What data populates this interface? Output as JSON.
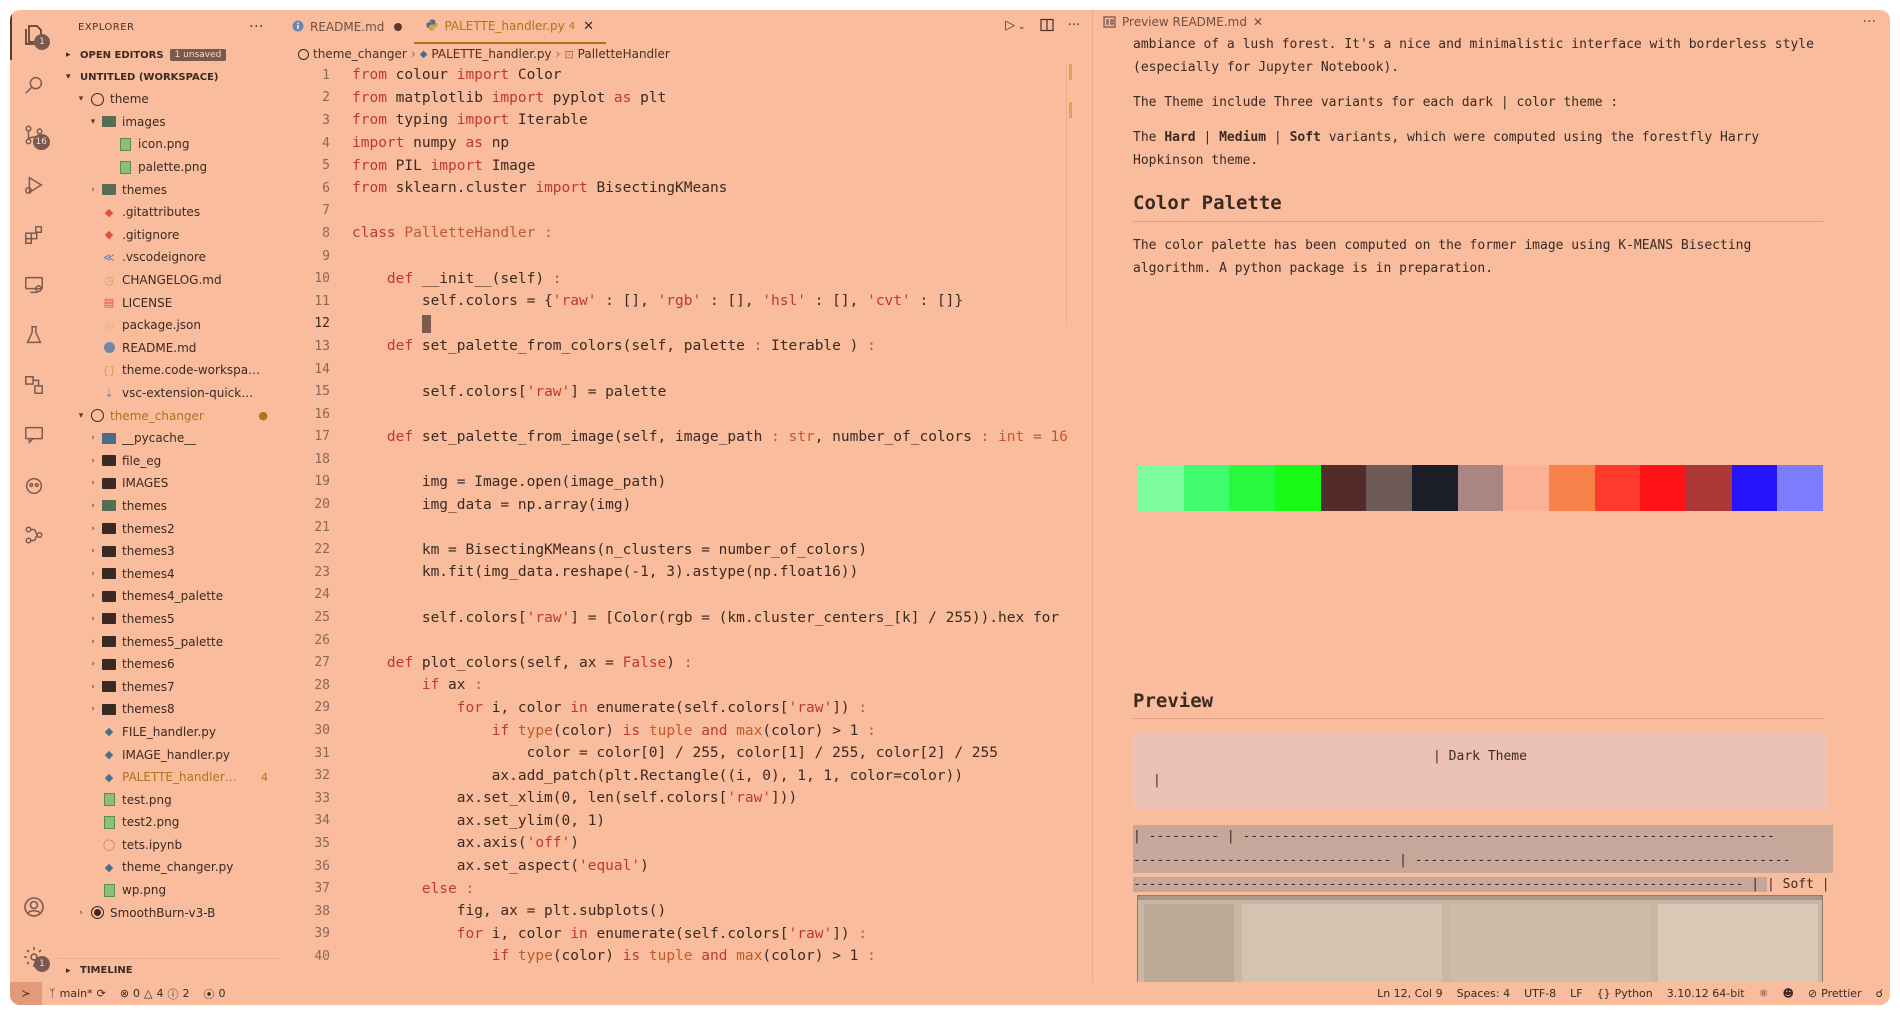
{
  "activity": {
    "explorer_badge": "1",
    "scm_badge": "16",
    "settings_badge": "1"
  },
  "sidebar": {
    "title": "EXPLORER",
    "open_editors": "OPEN EDITORS",
    "unsaved": "1 unsaved",
    "workspace": "UNTITLED (WORKSPACE)",
    "timeline": "TIMELINE",
    "tree": [
      {
        "label": "theme",
        "indent": 1,
        "kind": "root",
        "chev": "v"
      },
      {
        "label": "images",
        "indent": 2,
        "kind": "imgfolder",
        "chev": "v"
      },
      {
        "label": "icon.png",
        "indent": 3,
        "kind": "image",
        "chev": ""
      },
      {
        "label": "palette.png",
        "indent": 3,
        "kind": "image",
        "chev": ""
      },
      {
        "label": "themes",
        "indent": 2,
        "kind": "imgfolder",
        "chev": ">"
      },
      {
        "label": ".gitattributes",
        "indent": 2,
        "kind": "git",
        "chev": ""
      },
      {
        "label": ".gitignore",
        "indent": 2,
        "kind": "git",
        "chev": ""
      },
      {
        "label": ".vscodeignore",
        "indent": 2,
        "kind": "vscode",
        "chev": ""
      },
      {
        "label": "CHANGELOG.md",
        "indent": 2,
        "kind": "changelog",
        "chev": ""
      },
      {
        "label": "LICENSE",
        "indent": 2,
        "kind": "license",
        "chev": ""
      },
      {
        "label": "package.json",
        "indent": 2,
        "kind": "npm",
        "chev": ""
      },
      {
        "label": "README.md",
        "indent": 2,
        "kind": "info",
        "chev": ""
      },
      {
        "label": "theme.code-workspace",
        "indent": 2,
        "kind": "json",
        "chev": ""
      },
      {
        "label": "vsc-extension-quick…",
        "indent": 2,
        "kind": "md",
        "chev": ""
      },
      {
        "label": "theme_changer",
        "indent": 1,
        "kind": "root",
        "chev": "v",
        "modified": true,
        "mark": "●"
      },
      {
        "label": "__pycache__",
        "indent": 2,
        "kind": "pyfolder",
        "chev": ">"
      },
      {
        "label": "file_eg",
        "indent": 2,
        "kind": "folder",
        "chev": ">"
      },
      {
        "label": "IMAGES",
        "indent": 2,
        "kind": "folder",
        "chev": ">"
      },
      {
        "label": "themes",
        "indent": 2,
        "kind": "imgfolder",
        "chev": ">"
      },
      {
        "label": "themes2",
        "indent": 2,
        "kind": "folder",
        "chev": ">"
      },
      {
        "label": "themes3",
        "indent": 2,
        "kind": "folder",
        "chev": ">"
      },
      {
        "label": "themes4",
        "indent": 2,
        "kind": "folder",
        "chev": ">"
      },
      {
        "label": "themes4_palette",
        "indent": 2,
        "kind": "folder",
        "chev": ">"
      },
      {
        "label": "themes5",
        "indent": 2,
        "kind": "folder",
        "chev": ">"
      },
      {
        "label": "themes5_palette",
        "indent": 2,
        "kind": "folder",
        "chev": ">"
      },
      {
        "label": "themes6",
        "indent": 2,
        "kind": "folder",
        "chev": ">"
      },
      {
        "label": "themes7",
        "indent": 2,
        "kind": "folder",
        "chev": ">"
      },
      {
        "label": "themes8",
        "indent": 2,
        "kind": "folder",
        "chev": ">"
      },
      {
        "label": "FILE_handler.py",
        "indent": 2,
        "kind": "python",
        "chev": ""
      },
      {
        "label": "IMAGE_handler.py",
        "indent": 2,
        "kind": "python",
        "chev": ""
      },
      {
        "label": "PALETTE_handler…",
        "indent": 2,
        "kind": "python",
        "chev": "",
        "modified": true,
        "mark": "4"
      },
      {
        "label": "test.png",
        "indent": 2,
        "kind": "image",
        "chev": ""
      },
      {
        "label": "test2.png",
        "indent": 2,
        "kind": "image",
        "chev": ""
      },
      {
        "label": "tets.ipynb",
        "indent": 2,
        "kind": "notebook",
        "chev": ""
      },
      {
        "label": "theme_changer.py",
        "indent": 2,
        "kind": "python",
        "chev": ""
      },
      {
        "label": "wp.png",
        "indent": 2,
        "kind": "image",
        "chev": ""
      },
      {
        "label": "SmoothBurn-v3-B",
        "indent": 1,
        "kind": "root2",
        "chev": ">"
      }
    ]
  },
  "editor": {
    "tabs": [
      {
        "label": "README.md",
        "icon": "info",
        "dirty": true
      },
      {
        "label": "PALETTE_handler.py",
        "icon": "python",
        "count": "4",
        "active": true
      }
    ],
    "breadcrumb": [
      "theme_changer",
      "PALETTE_handler.py",
      "PalletteHandler"
    ],
    "current_line": "12",
    "lines": [
      {
        "n": "1",
        "tokens": [
          [
            "kw",
            "from "
          ],
          [
            "",
            "colour "
          ],
          [
            "kw",
            "import "
          ],
          [
            "",
            "Color"
          ]
        ]
      },
      {
        "n": "2",
        "tokens": [
          [
            "kw",
            "from "
          ],
          [
            "",
            "matplotlib "
          ],
          [
            "kw",
            "import "
          ],
          [
            "",
            "pyplot "
          ],
          [
            "kw",
            "as "
          ],
          [
            "",
            "plt"
          ]
        ]
      },
      {
        "n": "3",
        "tokens": [
          [
            "kw",
            "from "
          ],
          [
            "",
            "typing "
          ],
          [
            "kw",
            "import "
          ],
          [
            "",
            "Iterable"
          ]
        ]
      },
      {
        "n": "4",
        "tokens": [
          [
            "kw",
            "import "
          ],
          [
            "",
            "numpy "
          ],
          [
            "kw",
            "as "
          ],
          [
            "",
            "np"
          ]
        ]
      },
      {
        "n": "5",
        "tokens": [
          [
            "kw",
            "from "
          ],
          [
            "",
            "PIL "
          ],
          [
            "kw",
            "import "
          ],
          [
            "",
            "Image"
          ]
        ]
      },
      {
        "n": "6",
        "tokens": [
          [
            "kw",
            "from "
          ],
          [
            "",
            "sklearn.cluster "
          ],
          [
            "kw",
            "import "
          ],
          [
            "",
            "BisectingKMeans"
          ]
        ]
      },
      {
        "n": "7",
        "tokens": []
      },
      {
        "n": "8",
        "tokens": [
          [
            "kw",
            "class "
          ],
          [
            "ty",
            "PalletteHandler "
          ],
          [
            "op",
            ":"
          ]
        ]
      },
      {
        "n": "9",
        "tokens": []
      },
      {
        "n": "10",
        "tokens": [
          [
            "",
            "    "
          ],
          [
            "kw",
            "def "
          ],
          [
            "",
            "__init__(self) "
          ],
          [
            "op",
            ":"
          ]
        ]
      },
      {
        "n": "11",
        "tokens": [
          [
            "",
            "        self.colors = {"
          ],
          [
            "st",
            "'raw'"
          ],
          [
            "",
            " : [], "
          ],
          [
            "st",
            "'rgb'"
          ],
          [
            "",
            " : [], "
          ],
          [
            "st",
            "'hsl'"
          ],
          [
            "",
            " : [], "
          ],
          [
            "st",
            "'cvt'"
          ],
          [
            "",
            " : []}"
          ]
        ]
      },
      {
        "n": "12",
        "tokens": [
          [
            "",
            "        "
          ],
          [
            "cursor",
            ""
          ]
        ]
      },
      {
        "n": "13",
        "tokens": [
          [
            "",
            "    "
          ],
          [
            "kw",
            "def "
          ],
          [
            "",
            "set_palette_from_colors(self, palette "
          ],
          [
            "op",
            ": "
          ],
          [
            "",
            "Iterable ) "
          ],
          [
            "op",
            ":"
          ]
        ]
      },
      {
        "n": "14",
        "tokens": []
      },
      {
        "n": "15",
        "tokens": [
          [
            "",
            "        self.colors["
          ],
          [
            "st",
            "'raw'"
          ],
          [
            "",
            "] = palette"
          ]
        ]
      },
      {
        "n": "16",
        "tokens": []
      },
      {
        "n": "17",
        "tokens": [
          [
            "",
            "    "
          ],
          [
            "kw",
            "def "
          ],
          [
            "",
            "set_palette_from_image(self, image_path "
          ],
          [
            "op",
            ": "
          ],
          [
            "ty",
            "str"
          ],
          [
            "",
            ", number_of_colors "
          ],
          [
            "op",
            ": "
          ],
          [
            "ty",
            "int "
          ],
          [
            "op",
            "= "
          ],
          [
            "ty",
            "16"
          ]
        ]
      },
      {
        "n": "18",
        "tokens": []
      },
      {
        "n": "19",
        "tokens": [
          [
            "",
            "        img = Image.open(image_path)"
          ]
        ]
      },
      {
        "n": "20",
        "tokens": [
          [
            "",
            "        img_data = np.array(img)"
          ]
        ]
      },
      {
        "n": "21",
        "tokens": []
      },
      {
        "n": "22",
        "tokens": [
          [
            "",
            "        km = BisectingKMeans(n_clusters = number_of_colors)"
          ]
        ]
      },
      {
        "n": "23",
        "tokens": [
          [
            "",
            "        km.fit(img_data.reshape(-1, 3).astype(np.float16))"
          ]
        ]
      },
      {
        "n": "24",
        "tokens": []
      },
      {
        "n": "25",
        "tokens": [
          [
            "",
            "        self.colors["
          ],
          [
            "st",
            "'raw'"
          ],
          [
            "",
            "] = [Color(rgb = (km.cluster_centers_[k] / 255)).hex for"
          ]
        ]
      },
      {
        "n": "26",
        "tokens": []
      },
      {
        "n": "27",
        "tokens": [
          [
            "",
            "    "
          ],
          [
            "kw",
            "def "
          ],
          [
            "",
            "plot_colors(self, ax = "
          ],
          [
            "kw",
            "False"
          ],
          [
            "",
            ") "
          ],
          [
            "op",
            ":"
          ]
        ]
      },
      {
        "n": "28",
        "tokens": [
          [
            "",
            "        "
          ],
          [
            "kw",
            "if "
          ],
          [
            "",
            "ax "
          ],
          [
            "op",
            ":"
          ]
        ]
      },
      {
        "n": "29",
        "tokens": [
          [
            "",
            "            "
          ],
          [
            "kw",
            "for "
          ],
          [
            "",
            "i, color "
          ],
          [
            "kw",
            "in "
          ],
          [
            "",
            "enumerate(self.colors["
          ],
          [
            "st",
            "'raw'"
          ],
          [
            "",
            "]) "
          ],
          [
            "op",
            ":"
          ]
        ]
      },
      {
        "n": "30",
        "tokens": [
          [
            "",
            "                "
          ],
          [
            "kw",
            "if "
          ],
          [
            "ty",
            "type"
          ],
          [
            "",
            "(color) "
          ],
          [
            "kw",
            "is "
          ],
          [
            "ty",
            "tuple "
          ],
          [
            "kw",
            "and "
          ],
          [
            "ty",
            "max"
          ],
          [
            "",
            "(color) > 1 "
          ],
          [
            "op",
            ":"
          ]
        ]
      },
      {
        "n": "31",
        "tokens": [
          [
            "",
            "                    color = color[0] / 255, color[1] / 255, color[2] / 255"
          ]
        ]
      },
      {
        "n": "32",
        "tokens": [
          [
            "",
            "                ax.add_patch(plt.Rectangle((i, 0), 1, 1, color=color))"
          ]
        ]
      },
      {
        "n": "33",
        "tokens": [
          [
            "",
            "            ax.set_xlim(0, len(self.colors["
          ],
          [
            "st",
            "'raw'"
          ],
          [
            "",
            "]))"
          ]
        ]
      },
      {
        "n": "34",
        "tokens": [
          [
            "",
            "            ax.set_ylim(0, 1)"
          ]
        ]
      },
      {
        "n": "35",
        "tokens": [
          [
            "",
            "            ax.axis("
          ],
          [
            "st",
            "'off'"
          ],
          [
            "",
            ")"
          ]
        ]
      },
      {
        "n": "36",
        "tokens": [
          [
            "",
            "            ax.set_aspect("
          ],
          [
            "st",
            "'equal'"
          ],
          [
            "",
            ")"
          ]
        ]
      },
      {
        "n": "37",
        "tokens": [
          [
            "",
            "        "
          ],
          [
            "kw",
            "else "
          ],
          [
            "op",
            ":"
          ]
        ]
      },
      {
        "n": "38",
        "tokens": [
          [
            "",
            "            fig, ax = plt.subplots()"
          ]
        ]
      },
      {
        "n": "39",
        "tokens": [
          [
            "",
            "            "
          ],
          [
            "kw",
            "for "
          ],
          [
            "",
            "i, color "
          ],
          [
            "kw",
            "in "
          ],
          [
            "",
            "enumerate(self.colors["
          ],
          [
            "st",
            "'raw'"
          ],
          [
            "",
            "]) "
          ],
          [
            "op",
            ":"
          ]
        ]
      },
      {
        "n": "40",
        "tokens": [
          [
            "",
            "                "
          ],
          [
            "kw",
            "if "
          ],
          [
            "ty",
            "type"
          ],
          [
            "",
            "(color) "
          ],
          [
            "kw",
            "is "
          ],
          [
            "ty",
            "tuple "
          ],
          [
            "kw",
            "and "
          ],
          [
            "ty",
            "max"
          ],
          [
            "",
            "(color) > 1 "
          ],
          [
            "op",
            ":"
          ]
        ]
      }
    ]
  },
  "preview": {
    "tab": "Preview README.md",
    "p1": "ambiance of a lush forest. It's a nice and minimalistic interface with borderless style (especially for Jupyter Notebook).",
    "p2": "The Theme include Three variants for each dark | color theme :",
    "p3a": "The ",
    "p3b": "Hard",
    "p3c": " | ",
    "p3d": "Medium",
    "p3e": " | ",
    "p3f": "Soft",
    "p3g": " variants, which were computed using the forestfly Harry Hopkinson theme.",
    "h_palette": "Color Palette",
    "p4": "The color palette has been computed on the former image using K-MEANS Bisecting algorithm. A python package is in preparation.",
    "palette_colors": [
      "#7ffd9f",
      "#40fb6d",
      "#27f93e",
      "#17fb14",
      "#532b2b",
      "#6e5959",
      "#1b1e27",
      "#a98683",
      "#fab194",
      "#f7834a",
      "#fe3a2c",
      "#fe1117",
      "#ab3737",
      "#2413fb",
      "#7c7cff"
    ],
    "h_preview": "Preview",
    "dark_theme": "| Dark Theme",
    "pipe": "|",
    "table_line1": "| --------- | --------------------------------------------------------------------",
    "table_line2": "--------------------------------- | ------------------------------------------------",
    "table_line3a": "------------------------------------------------------------------------------ | ",
    "table_line3b": "| Soft |"
  },
  "status": {
    "branch": "main*",
    "errors": "0",
    "warnings": "4",
    "infos": "2",
    "ports": "0",
    "position": "Ln 12, Col 9",
    "spaces": "Spaces: 4",
    "encoding": "UTF-8",
    "eol": "LF",
    "language": "Python",
    "interpreter": "3.10.12 64-bit",
    "prettier": "Prettier"
  }
}
